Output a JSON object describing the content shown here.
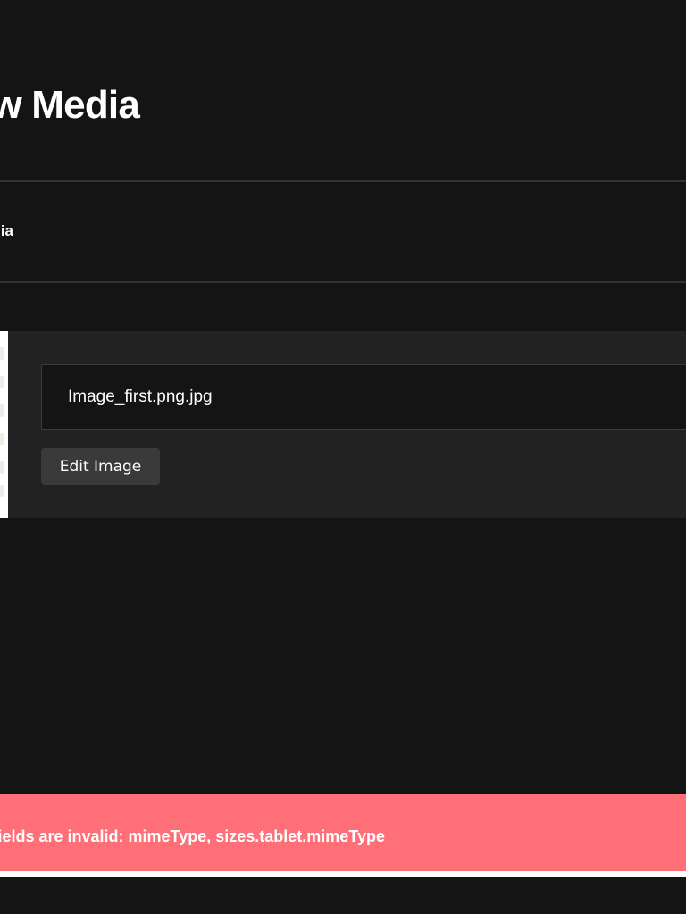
{
  "header": {
    "title": "New Media"
  },
  "tabs": [
    {
      "label": "Media"
    }
  ],
  "upload": {
    "filename": "Image_first.png.jpg",
    "edit_button_label": "Edit Image"
  },
  "toast": {
    "message": "The following fields are invalid: mimeType, sizes.tablet.mimeType",
    "color": "#ff6f77"
  },
  "colors": {
    "background": "#141414",
    "card": "#222222",
    "button": "#3a3a3a"
  }
}
